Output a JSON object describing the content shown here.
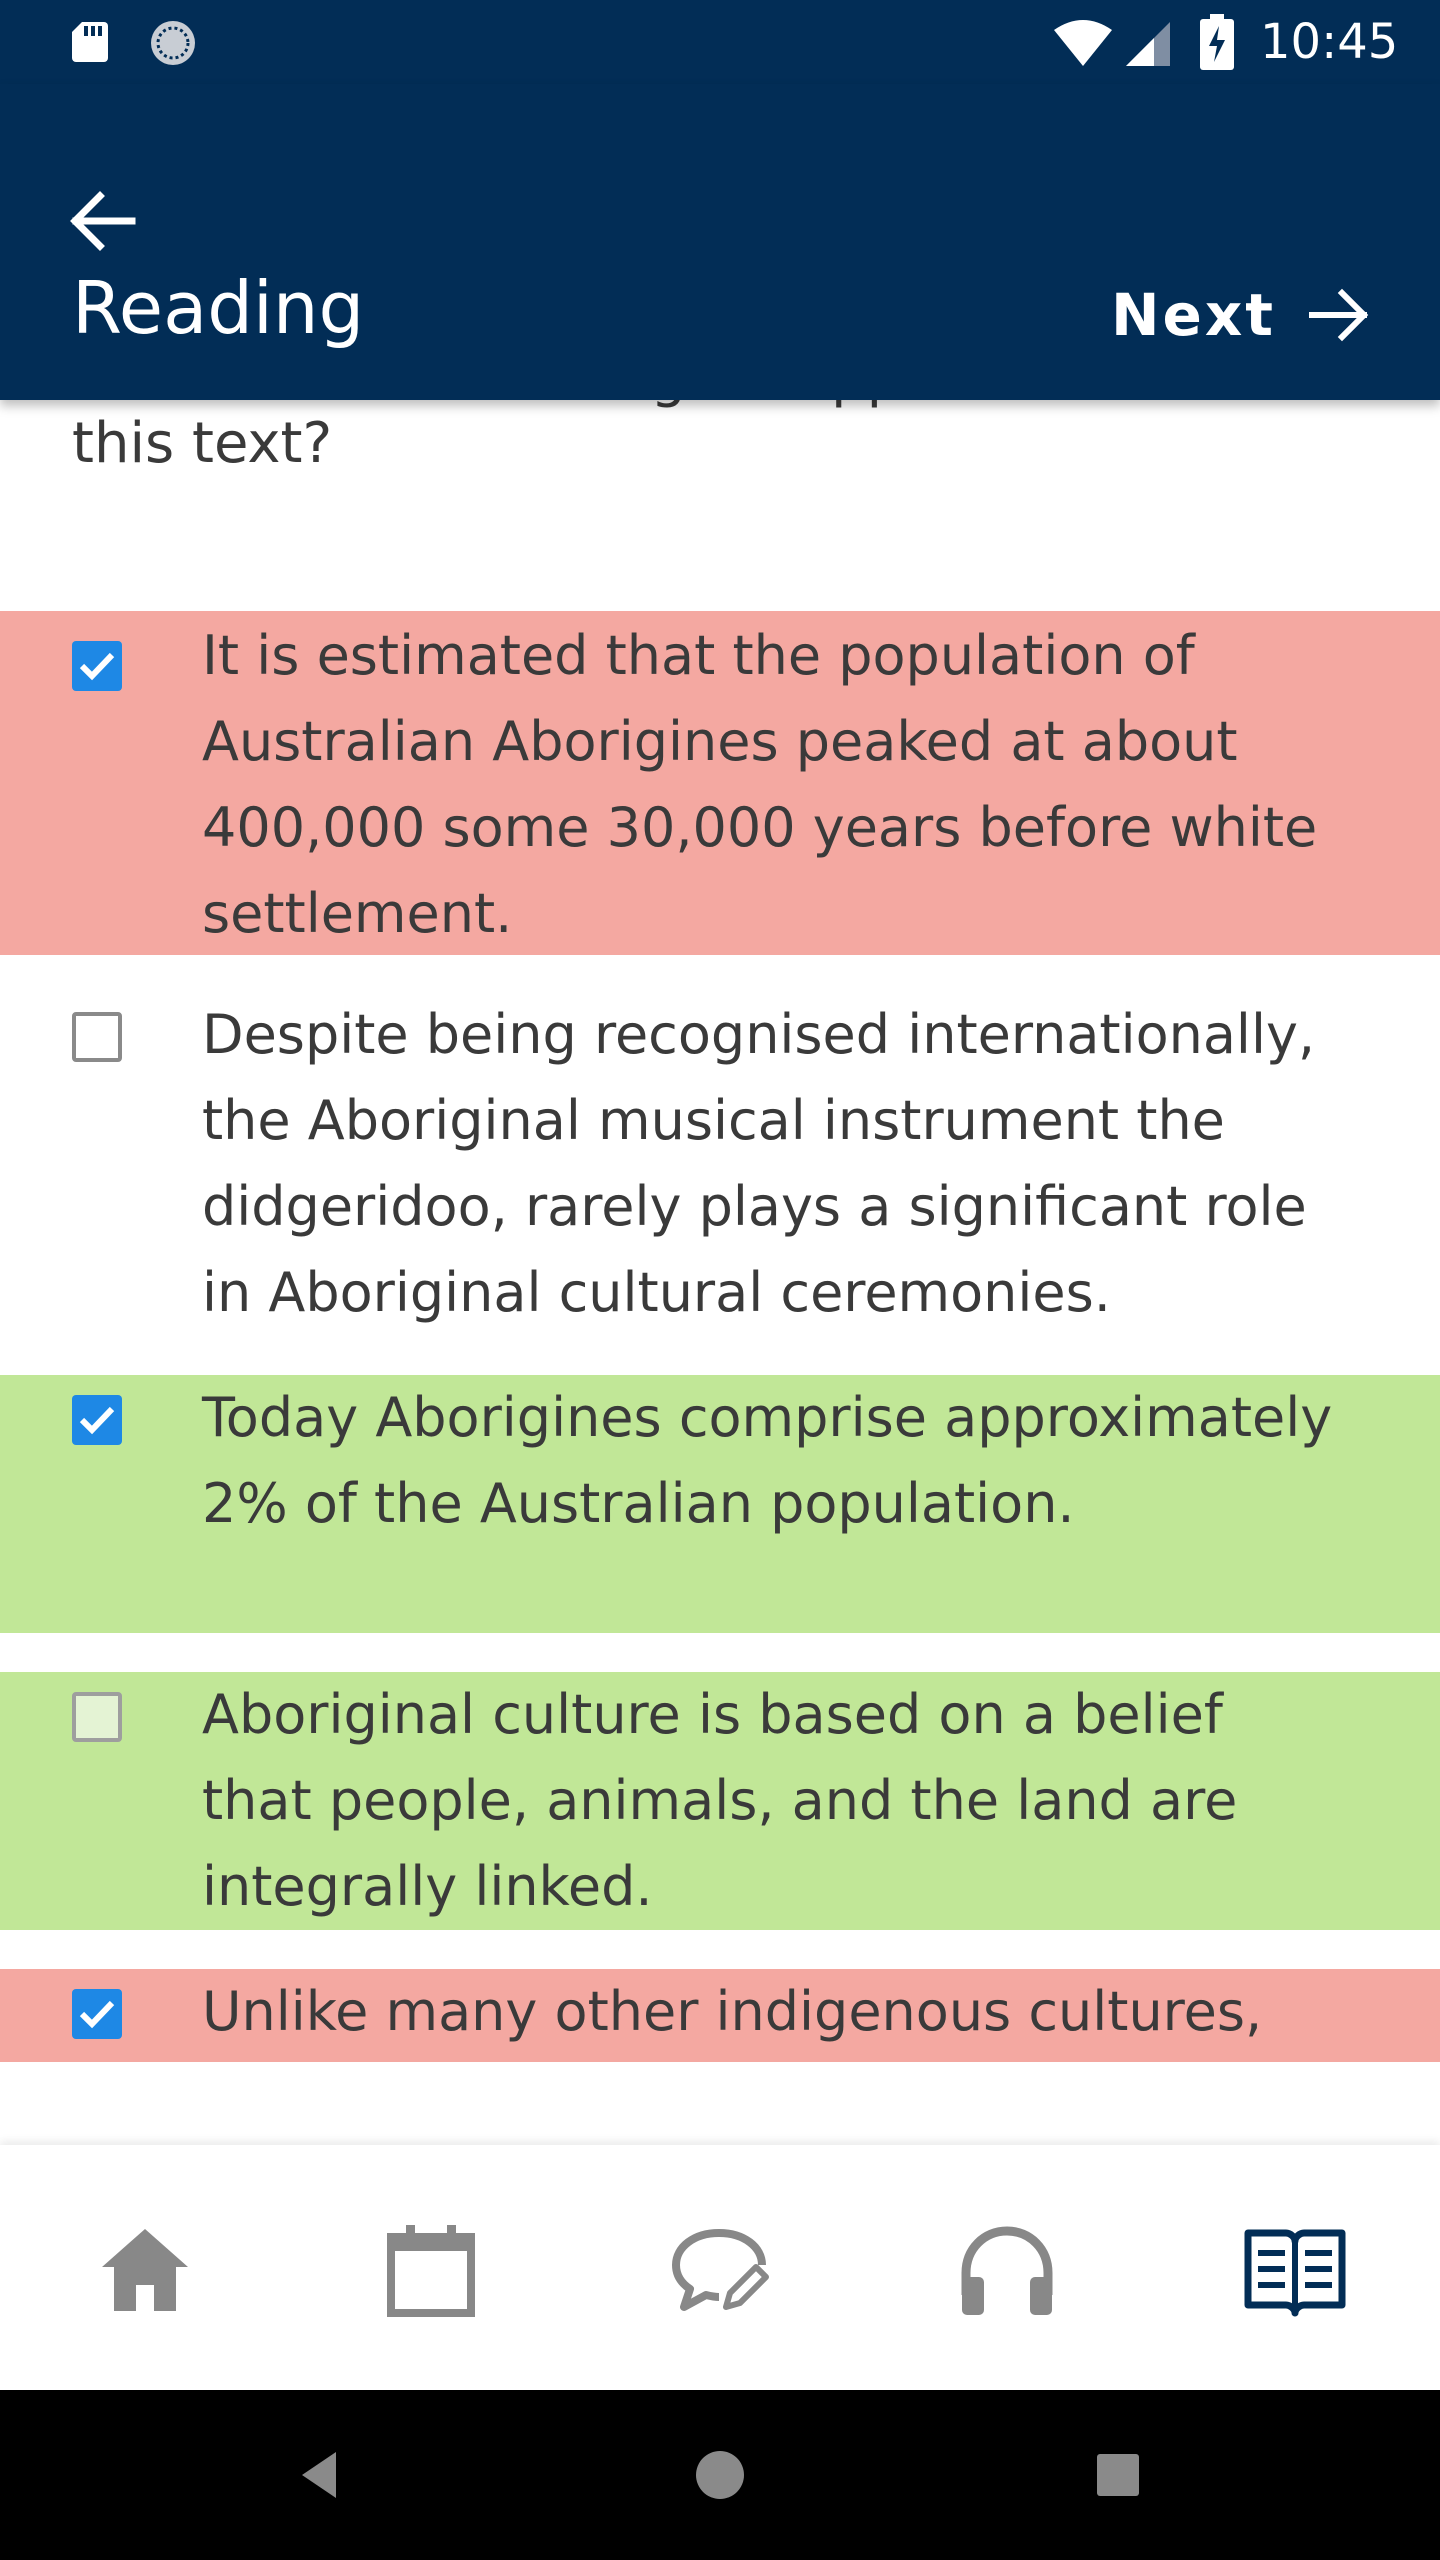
{
  "status_bar": {
    "time": "10:45",
    "icons": [
      "sd-card-icon",
      "sync-icon",
      "wifi-icon",
      "signal-icon",
      "battery-charging-icon"
    ]
  },
  "app_bar": {
    "title": "Reading",
    "next_label": "Next",
    "icons": [
      "back-arrow-icon",
      "forward-arrow-icon"
    ]
  },
  "question": {
    "partial_top_line": "which of the following is supported in",
    "visible_line": "this text?"
  },
  "options": [
    {
      "text": "It is estimated that the population of Australian Aborigines peaked at about 400,000 some 30,000 years before white settlement.",
      "checked": true,
      "state": "incorrect"
    },
    {
      "text": "Despite being recognised internationally, the Aboriginal musical instrument the didgeridoo, rarely plays a significant role in Aboriginal cultural ceremonies.",
      "checked": false,
      "state": "neutral"
    },
    {
      "text": "Today Aborigines comprise approximately 2% of the Australian population.",
      "checked": true,
      "state": "correct"
    },
    {
      "text": "Aboriginal culture is based on a belief that people, animals, and the land are integrally linked.",
      "checked": false,
      "state": "correct"
    },
    {
      "text": "Unlike many other indigenous cultures,",
      "checked": true,
      "state": "incorrect"
    }
  ],
  "colors": {
    "primary": "#022d56",
    "incorrect_bg": "#f4a8a1",
    "correct_bg": "#c1e797",
    "checkbox_checked": "#1e88e5",
    "nav_inactive": "#888888",
    "nav_active": "#022d56"
  },
  "bottom_nav": {
    "items": [
      {
        "icon": "home-icon",
        "active": false
      },
      {
        "icon": "calendar-icon",
        "active": false
      },
      {
        "icon": "speaking-chat-icon",
        "active": false
      },
      {
        "icon": "headphones-icon",
        "active": false
      },
      {
        "icon": "reading-book-icon",
        "active": true
      }
    ]
  },
  "system_nav": {
    "icons": [
      "back-triangle-icon",
      "home-circle-icon",
      "recents-square-icon"
    ]
  }
}
